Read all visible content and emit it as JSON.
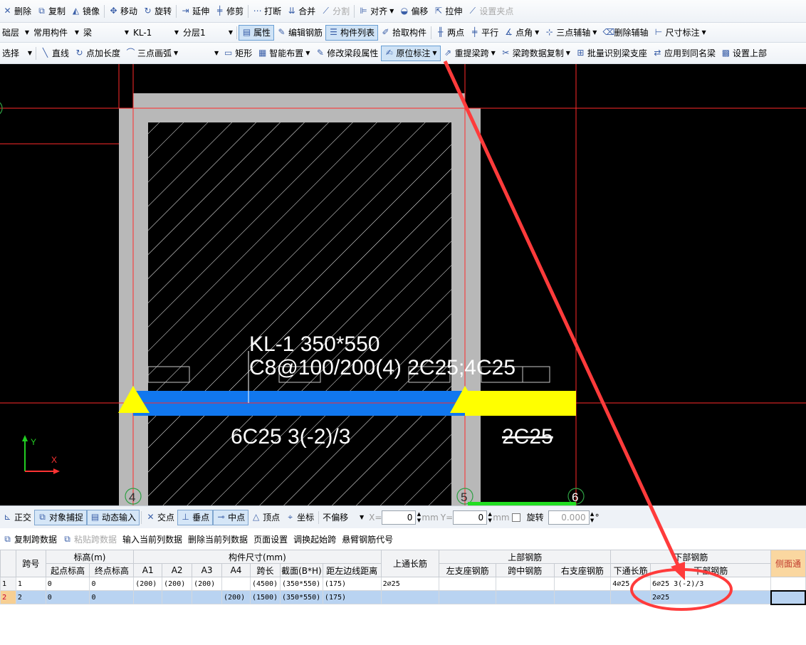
{
  "toolbar1": [
    {
      "icon": "delete-icon",
      "glyph": "✕",
      "label": "删除"
    },
    {
      "icon": "copy-icon",
      "glyph": "⧉",
      "label": "复制"
    },
    {
      "icon": "mirror-icon",
      "glyph": "◭",
      "label": "镜像"
    },
    {
      "icon": "move-icon",
      "glyph": "✥",
      "label": "移动"
    },
    {
      "icon": "rotate-icon",
      "glyph": "↻",
      "label": "旋转"
    },
    {
      "icon": "extend-icon",
      "glyph": "⇥",
      "label": "延伸"
    },
    {
      "icon": "trim-icon",
      "glyph": "╪",
      "label": "修剪"
    },
    {
      "icon": "break-icon",
      "glyph": "⋯",
      "label": "打断"
    },
    {
      "icon": "merge-icon",
      "glyph": "⇊",
      "label": "合并"
    },
    {
      "icon": "split-icon",
      "glyph": "⟋",
      "label": "分割",
      "disabled": true
    },
    {
      "icon": "align-icon",
      "glyph": "⊫",
      "label": "对齐",
      "dropdown": true
    },
    {
      "icon": "offset-icon",
      "glyph": "◒",
      "label": "偏移"
    },
    {
      "icon": "stretch-icon",
      "glyph": "⇱",
      "label": "拉伸"
    },
    {
      "icon": "set-grip-icon",
      "glyph": "⟋",
      "label": "设置夹点",
      "disabled": true
    }
  ],
  "toolbar2": {
    "floor": "础层",
    "category": "常用构件",
    "type": "梁",
    "component": "KL-1",
    "layer": "分层1",
    "buttons": [
      {
        "icon": "property-icon",
        "glyph": "▤",
        "label": "属性",
        "active": true
      },
      {
        "icon": "edit-rebar-icon",
        "glyph": "✎",
        "label": "编辑钢筋"
      },
      {
        "icon": "component-list-icon",
        "glyph": "☰",
        "label": "构件列表",
        "active": true
      },
      {
        "icon": "pick-component-icon",
        "glyph": "✐",
        "label": "拾取构件"
      },
      {
        "icon": "two-point-icon",
        "glyph": "╫",
        "label": "两点"
      },
      {
        "icon": "parallel-icon",
        "glyph": "╪",
        "label": "平行"
      },
      {
        "icon": "point-angle-icon",
        "glyph": "∡",
        "label": "点角",
        "dropdown": true
      },
      {
        "icon": "three-point-axis-icon",
        "glyph": "⊹",
        "label": "三点辅轴",
        "dropdown": true
      },
      {
        "icon": "delete-axis-icon",
        "glyph": "⌫",
        "label": "删除辅轴"
      },
      {
        "icon": "dimension-icon",
        "glyph": "⊢",
        "label": "尺寸标注",
        "dropdown": true
      }
    ]
  },
  "toolbar3": {
    "select": "选择",
    "buttons1": [
      {
        "icon": "line-icon",
        "glyph": "╲",
        "label": "直线"
      },
      {
        "icon": "point-length-icon",
        "glyph": "↻",
        "label": "点加长度"
      },
      {
        "icon": "arc-icon",
        "glyph": "⌒",
        "label": "三点画弧",
        "dropdown": true
      }
    ],
    "buttons2": [
      {
        "icon": "rectangle-icon",
        "glyph": "▭",
        "label": "矩形"
      },
      {
        "icon": "smart-layout-icon",
        "glyph": "▦",
        "label": "智能布置",
        "dropdown": true
      },
      {
        "icon": "modify-span-icon",
        "glyph": "✎",
        "label": "修改梁段属性"
      },
      {
        "icon": "in-situ-label-icon",
        "glyph": "✍",
        "label": "原位标注",
        "active": true,
        "dropdown": true
      },
      {
        "icon": "repick-span-icon",
        "glyph": "⇗",
        "label": "重提梁跨",
        "dropdown": true
      },
      {
        "icon": "span-copy-icon",
        "glyph": "✂",
        "label": "梁跨数据复制",
        "dropdown": true
      },
      {
        "icon": "batch-identify-icon",
        "glyph": "⊞",
        "label": "批量识别梁支座"
      },
      {
        "icon": "apply-same-icon",
        "glyph": "⇄",
        "label": "应用到同名梁"
      },
      {
        "icon": "set-top-icon",
        "glyph": "▩",
        "label": "设置上部"
      }
    ]
  },
  "drawing": {
    "beam_name": "KL-1 350*550",
    "beam_stirrup": "C8@100/200(4) 2C25;4C25",
    "bottom_label": "6C25 3(-2)/3",
    "span2_label": "2C25",
    "axis_labels": [
      "4",
      "5",
      "6"
    ],
    "ucs_x": "X",
    "ucs_y": "Y",
    "colors": {
      "beam": "#1177ee",
      "yellow": "#ffff00",
      "red": "#ff2a2a",
      "column": "#b8b8b8"
    }
  },
  "snapbar": {
    "ortho": "正交",
    "object_snap": "对象捕捉",
    "dynamic_input": "动态输入",
    "intersection": "交点",
    "perpendicular": "垂点",
    "midpoint": "中点",
    "vertex": "顶点",
    "coordinate": "坐标",
    "offset_mode": "不偏移",
    "x_label": "X=",
    "x_value": "0",
    "y_label": "Y=",
    "y_value": "0",
    "unit_mm": "mm",
    "rotate_label": "旋转",
    "rotate_value": "0.000",
    "degree": "°"
  },
  "gridbar": [
    {
      "icon": "copy-span-icon",
      "label": "复制跨数据"
    },
    {
      "icon": "paste-span-icon",
      "label": "粘贴跨数据",
      "disabled": true
    },
    {
      "label": "输入当前列数据"
    },
    {
      "label": "删除当前列数据"
    },
    {
      "label": "页面设置"
    },
    {
      "label": "调换起始跨"
    },
    {
      "label": "悬臂钢筋代号"
    }
  ],
  "table": {
    "groups": {
      "span": "跨号",
      "elevation": "标高(m)",
      "size": "构件尺寸(mm)",
      "top_through": "上通长筋",
      "top_rebar": "上部钢筋",
      "bottom_rebar": "下部钢筋",
      "side": "侧面通"
    },
    "sub": {
      "start_elev": "起点标高",
      "end_elev": "终点标高",
      "a1": "A1",
      "a2": "A2",
      "a3": "A3",
      "a4": "A4",
      "span_len": "跨长",
      "section": "截面(B*H)",
      "left_dist": "距左边线距离",
      "left_support": "左支座钢筋",
      "mid_span": "跨中钢筋",
      "right_support": "右支座钢筋",
      "bottom_through": "下通长筋",
      "bottom": "下部钢筋"
    },
    "rows": [
      {
        "row": "1",
        "span": "1",
        "start": "0",
        "end": "0",
        "a1": "(200)",
        "a2": "(200)",
        "a3": "(200)",
        "a4": "",
        "len": "(4500)",
        "section": "(350*550)",
        "dist": "(175)",
        "top_through": "2⌀25",
        "left": "",
        "mid": "",
        "right": "",
        "bottom_through": "4⌀25",
        "bottom": "6⌀25 3(-2)/3"
      },
      {
        "row": "2",
        "span": "2",
        "start": "0",
        "end": "0",
        "a1": "",
        "a2": "",
        "a3": "",
        "a4": "(200)",
        "len": "(1500)",
        "section": "(350*550)",
        "dist": "(175)",
        "top_through": "",
        "left": "",
        "mid": "",
        "right": "",
        "bottom_through": "",
        "bottom": "2⌀25"
      }
    ]
  }
}
